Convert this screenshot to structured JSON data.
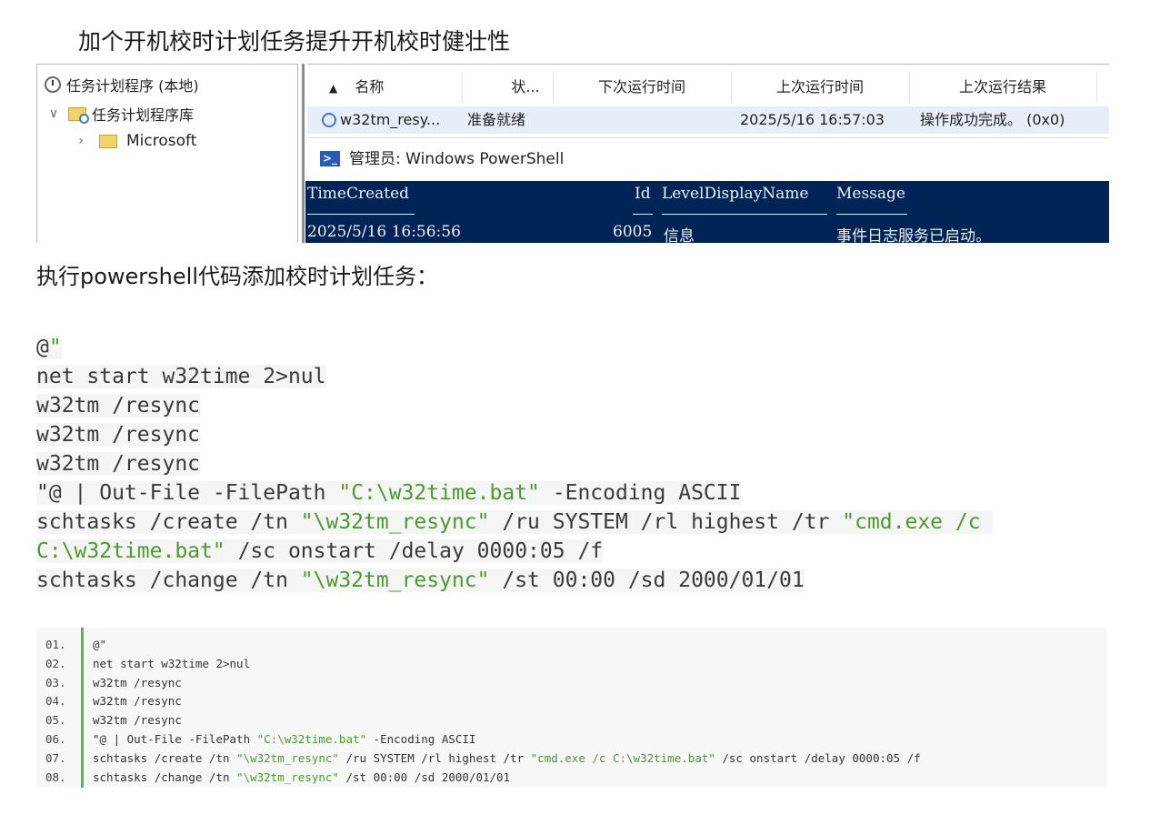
{
  "title": "加个开机校时计划任务提升开机校时健壮性",
  "tree": {
    "root": "任务计划程序 (本地)",
    "library": "任务计划程序库",
    "microsoft": "Microsoft"
  },
  "columns": [
    "名称",
    "状...",
    "下次运行时间",
    "上次运行时间",
    "上次运行结果"
  ],
  "sort_arrow": "▲",
  "task": {
    "name": "w32tm_resy...",
    "status": "准备就绪",
    "next_run": "",
    "last_run": "2025/5/16 16:57:03",
    "last_result": "操作成功完成。 (0x0)"
  },
  "powershell": {
    "title": "管理员: Windows PowerShell",
    "headers": [
      "TimeCreated",
      "Id",
      "LevelDisplayName",
      "Message"
    ],
    "row": [
      "2025/5/16 16:56:56",
      "6005",
      "信息",
      "事件日志服务已启动。"
    ]
  },
  "intro": "执行powershell代码添加校时计划任务：",
  "code_lines": [
    {
      "a": "@",
      "s": "\"",
      "b": "",
      "s2": "",
      "c": "",
      "s3": "",
      "d": ""
    },
    {
      "a": "net start w32time 2>nul",
      "s": "",
      "b": "",
      "s2": "",
      "c": "",
      "s3": "",
      "d": ""
    },
    {
      "a": "w32tm /resync",
      "s": "",
      "b": "",
      "s2": "",
      "c": "",
      "s3": "",
      "d": ""
    },
    {
      "a": "w32tm /resync",
      "s": "",
      "b": "",
      "s2": "",
      "c": "",
      "s3": "",
      "d": ""
    },
    {
      "a": "w32tm /resync",
      "s": "",
      "b": "",
      "s2": "",
      "c": "",
      "s3": "",
      "d": ""
    },
    {
      "a": "\"@ | Out-File -FilePath ",
      "s": "\"C:\\w32time.bat\"",
      "b": " -Encoding ASCII",
      "s2": "",
      "c": "",
      "s3": "",
      "d": ""
    },
    {
      "a": "schtasks /create /tn ",
      "s": "\"\\w32tm_resync\"",
      "b": " /ru SYSTEM /rl highest /tr ",
      "s2": "\"cmd.exe /c ",
      "c": "",
      "s3": "",
      "d": ""
    },
    {
      "a": "",
      "s": "C:\\w32time.bat\"",
      "b": " /sc onstart /delay 0000:05 /f",
      "s2": "",
      "c": "",
      "s3": "",
      "d": ""
    },
    {
      "a": "schtasks /change /tn ",
      "s": "\"\\w32tm_resync\"",
      "b": " /st 00:00 /sd 2000/01/01",
      "s2": "",
      "c": "",
      "s3": "",
      "d": ""
    }
  ],
  "listing": [
    {
      "n": "01.",
      "a": "@\"",
      "s": "",
      "b": "",
      "s2": "",
      "c": ""
    },
    {
      "n": "02.",
      "a": "net start w32time 2>nul",
      "s": "",
      "b": "",
      "s2": "",
      "c": ""
    },
    {
      "n": "03.",
      "a": "w32tm /resync",
      "s": "",
      "b": "",
      "s2": "",
      "c": ""
    },
    {
      "n": "04.",
      "a": "w32tm /resync",
      "s": "",
      "b": "",
      "s2": "",
      "c": ""
    },
    {
      "n": "05.",
      "a": "w32tm /resync",
      "s": "",
      "b": "",
      "s2": "",
      "c": ""
    },
    {
      "n": "06.",
      "a": "\"@ | Out-File -FilePath ",
      "s": "\"C:\\w32time.bat\"",
      "b": " -Encoding ASCII",
      "s2": "",
      "c": ""
    },
    {
      "n": "07.",
      "a": "schtasks /create /tn ",
      "s": "\"\\w32tm_resync\"",
      "b": " /ru SYSTEM /rl highest /tr ",
      "s2": "\"cmd.exe /c C:\\w32time.bat\"",
      "c": " /sc onstart /delay 0000:05 /f"
    },
    {
      "n": "08.",
      "a": "schtasks /change /tn ",
      "s": "\"\\w32tm_resync\"",
      "b": " /st 00:00 /sd 2000/01/01",
      "s2": "",
      "c": ""
    }
  ],
  "colors": {
    "string": "#4a9a2e",
    "ps_bg": "#012456",
    "gutter": "#55b84a"
  }
}
